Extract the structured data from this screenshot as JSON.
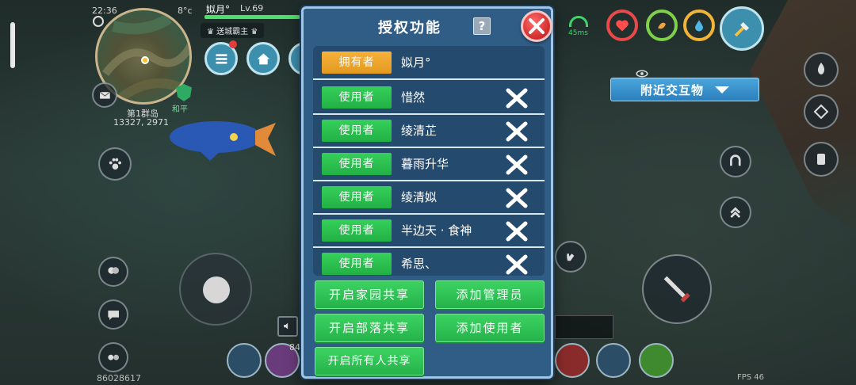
{
  "hud": {
    "time": "22:36",
    "temperature": "8°c",
    "player_name": "姒月°",
    "player_level": "Lv.69",
    "title_tag": "送城霸主",
    "peace_label": "和平",
    "location_name": "第1群岛",
    "coordinates": "13327, 2971",
    "player_id": "86028617",
    "fps": "FPS 46",
    "signal": "45ms",
    "quick_slot_count": "84",
    "nearby_interact_label": "附近交互物"
  },
  "dialog": {
    "title": "授权功能",
    "help_label": "?",
    "owner": {
      "role": "拥有者",
      "name": "姒月°"
    },
    "members": [
      {
        "role": "使用者",
        "name": "惜然"
      },
      {
        "role": "使用者",
        "name": "绫清芷"
      },
      {
        "role": "使用者",
        "name": "暮雨升华"
      },
      {
        "role": "使用者",
        "name": "绫清姒"
      },
      {
        "role": "使用者",
        "name": "半边天 · 食神"
      },
      {
        "role": "使用者",
        "name": "希思、"
      }
    ],
    "buttons": {
      "share_home": "开启家园共享",
      "add_admin": "添加管理员",
      "share_tribe": "开启部落共享",
      "add_user": "添加使用者",
      "share_all": "开启所有人共享"
    }
  },
  "colors": {
    "dialog_bg": "#2f5d86",
    "role_user": "#22b045",
    "role_owner": "#e39a20",
    "close_button": "#d12a2a",
    "nearby_button": "#2c7fbc"
  }
}
